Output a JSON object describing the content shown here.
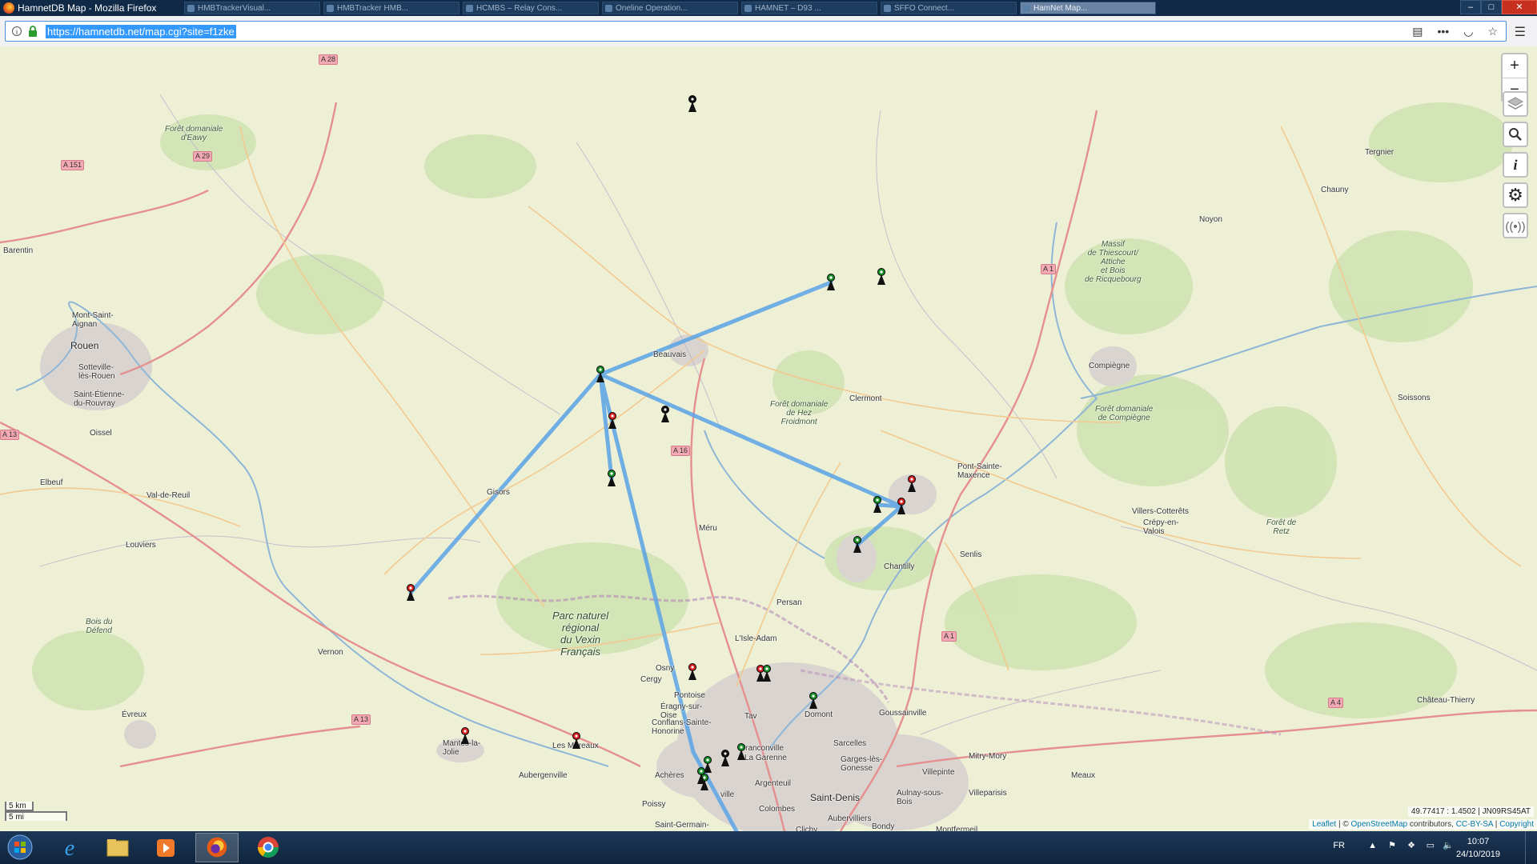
{
  "window": {
    "title": "HamnetDB Map - Mozilla Firefox"
  },
  "browser_tabs": [
    "HMBTrackerVisual...",
    "HMBTracker HMB...",
    "HCMBS – Relay Cons...",
    "Oneline Operation...",
    "HAMNET – D93 ...",
    "SFFO Connect...",
    "HamNet Map..."
  ],
  "address_bar": {
    "url": "https://hamnetdb.net/map.cgi?site=f1zke"
  },
  "map": {
    "places": [
      {
        "name": "Rouen",
        "cls": "city"
      },
      {
        "name": "Beauvais",
        "cls": ""
      },
      {
        "name": "Compiègne",
        "cls": ""
      },
      {
        "name": "Saint-Denis",
        "cls": "city"
      },
      {
        "name": "Mont-Saint-\nAignan",
        "cls": ""
      },
      {
        "name": "Sotteville-\nlès-Rouen",
        "cls": ""
      },
      {
        "name": "Saint-Étienne-\ndu-Rouvray",
        "cls": ""
      },
      {
        "name": "Oissel",
        "cls": ""
      },
      {
        "name": "Elbeuf",
        "cls": ""
      },
      {
        "name": "Val-de-Reuil",
        "cls": ""
      },
      {
        "name": "Louviers",
        "cls": ""
      },
      {
        "name": "Barentin",
        "cls": ""
      },
      {
        "name": "Gisors",
        "cls": ""
      },
      {
        "name": "Méru",
        "cls": ""
      },
      {
        "name": "Clermont",
        "cls": ""
      },
      {
        "name": "Chantilly",
        "cls": ""
      },
      {
        "name": "Senlis",
        "cls": ""
      },
      {
        "name": "Pont-Sainte-\nMaxence",
        "cls": ""
      },
      {
        "name": "Crépy-en-\nValois",
        "cls": ""
      },
      {
        "name": "Villers-Cotterêts",
        "cls": ""
      },
      {
        "name": "Soissons",
        "cls": ""
      },
      {
        "name": "Noyon",
        "cls": ""
      },
      {
        "name": "Chauny",
        "cls": ""
      },
      {
        "name": "Tergnier",
        "cls": ""
      },
      {
        "name": "Persan",
        "cls": ""
      },
      {
        "name": "L'Isle-Adam",
        "cls": ""
      },
      {
        "name": "Vernon",
        "cls": ""
      },
      {
        "name": "Évreux",
        "cls": ""
      },
      {
        "name": "Mantes-la-\nJolie",
        "cls": ""
      },
      {
        "name": "Les Mureaux",
        "cls": ""
      },
      {
        "name": "Aubergenville",
        "cls": ""
      },
      {
        "name": "Osny",
        "cls": ""
      },
      {
        "name": "Cergy",
        "cls": ""
      },
      {
        "name": "Pontoise",
        "cls": ""
      },
      {
        "name": "Éragny-sur-\nOise",
        "cls": ""
      },
      {
        "name": "Conflans-Sainte-\nHonorine",
        "cls": ""
      },
      {
        "name": "Achères",
        "cls": ""
      },
      {
        "name": "Poissy",
        "cls": ""
      },
      {
        "name": "Saint-Germain-",
        "cls": ""
      },
      {
        "name": "Franconville",
        "cls": ""
      },
      {
        "name": "La Garenne",
        "cls": ""
      },
      {
        "name": "Argenteuil",
        "cls": ""
      },
      {
        "name": "Colombes",
        "cls": ""
      },
      {
        "name": "Domont",
        "cls": ""
      },
      {
        "name": "Sarcelles",
        "cls": ""
      },
      {
        "name": "Garges-lès-\nGonesse",
        "cls": ""
      },
      {
        "name": "Goussainville",
        "cls": ""
      },
      {
        "name": "Villepinte",
        "cls": ""
      },
      {
        "name": "Aulnay-sous-\nBois",
        "cls": ""
      },
      {
        "name": "Villeparisis",
        "cls": ""
      },
      {
        "name": "Mitry-Mory",
        "cls": ""
      },
      {
        "name": "Aubervilliers",
        "cls": ""
      },
      {
        "name": "Bondy",
        "cls": ""
      },
      {
        "name": "Montfermeil",
        "cls": ""
      },
      {
        "name": "Clichy",
        "cls": ""
      },
      {
        "name": "Meaux",
        "cls": ""
      },
      {
        "name": "Château-Thierry",
        "cls": ""
      },
      {
        "name": "Tav",
        "cls": ""
      },
      {
        "name": "ville",
        "cls": ""
      }
    ],
    "forests": [
      "Forêt domaniale\nd'Eawy",
      "Forêt domaniale\nde Hez\nFroidmont",
      "Forêt domaniale\nde Compiègne",
      "Massif\nde Thiescourt/\nAttiche\net Bois\nde Ricquebourg",
      "Forêt de\nRetz",
      "Bois du\nDéfend"
    ],
    "park": "Parc naturel\nrégional\ndu Vexin\nFrançais",
    "roads": [
      "A 28",
      "A 29",
      "A 151",
      "A 13",
      "A 16",
      "A 1",
      "A 1",
      "A 13",
      "A 4"
    ],
    "markers": [
      {
        "status": "black"
      },
      {
        "status": "green"
      },
      {
        "status": "green"
      },
      {
        "status": "green"
      },
      {
        "status": "red"
      },
      {
        "status": "black"
      },
      {
        "status": "green"
      },
      {
        "status": "red"
      },
      {
        "status": "red"
      },
      {
        "status": "green"
      },
      {
        "status": "green"
      },
      {
        "status": "red"
      },
      {
        "status": "red"
      },
      {
        "status": "red"
      },
      {
        "status": "red"
      },
      {
        "status": "red"
      },
      {
        "status": "green"
      },
      {
        "status": "green"
      },
      {
        "status": "green"
      },
      {
        "status": "green"
      },
      {
        "status": "black"
      },
      {
        "status": "green"
      },
      {
        "status": "green"
      }
    ],
    "colors": {
      "green": "#1a8f2a",
      "red": "#d42020",
      "black": "#111111",
      "link": "#5aa3e6"
    }
  },
  "controls": {
    "zoom_in": "+",
    "zoom_out": "−",
    "scale_km": "5 km",
    "scale_mi": "5 mi",
    "coords": "49.77417 : 1.4502 | JN09RS45AT",
    "attribution": {
      "leaflet": "Leaflet",
      "sep1": " | © ",
      "osm": "OpenStreetMap",
      "contrib": " contributors, ",
      "license": "CC-BY-SA",
      "sep2": " | ",
      "copyright": "Copyright"
    }
  },
  "taskbar": {
    "lang": "FR",
    "time": "10:07",
    "date": "24/10/2019"
  }
}
